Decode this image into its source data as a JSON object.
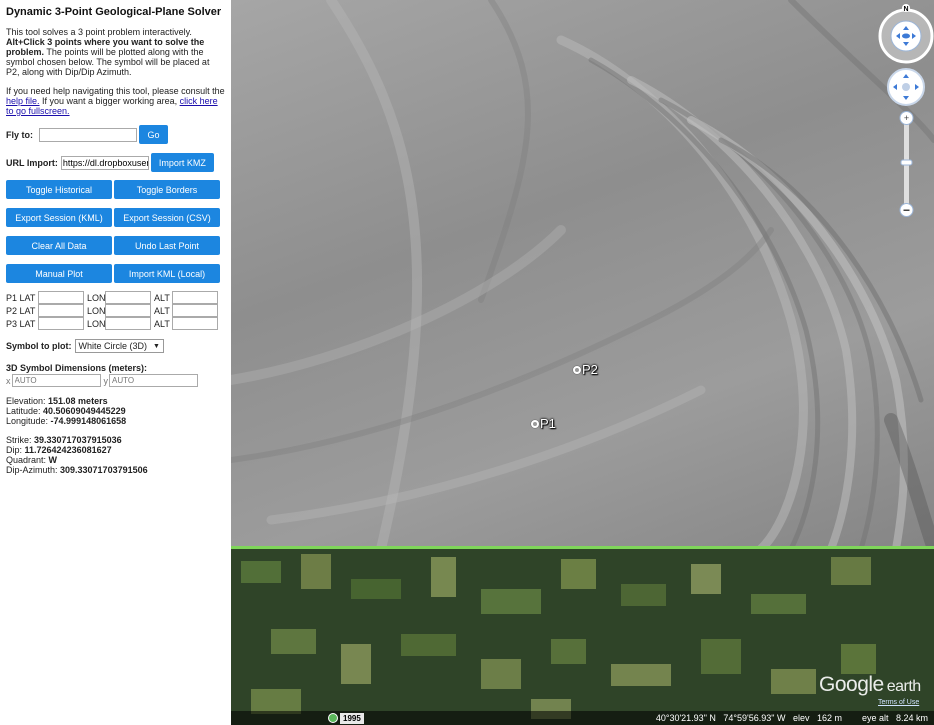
{
  "panel": {
    "title": "Dynamic 3-Point Geological-Plane Solver",
    "intro_line1": "This tool solves a 3 point problem interactively.",
    "intro_bold": "Alt+Click 3 points where you want to solve the problem.",
    "intro_rest": " The points will be plotted along with the symbol chosen below. The symbol will be placed at P2, along with Dip/Dip Azimuth.",
    "help_prefix": "If you need help navigating this tool, please consult the ",
    "help_link": "help file.",
    "help_mid": " If you want a bigger working area, ",
    "fullscreen_link": "click here to go fullscreen.",
    "fly_label": "Fly to:",
    "fly_value": "",
    "go_label": "Go",
    "url_label": "URL Import:",
    "url_value": "https://dl.dropboxuser",
    "import_kmz_label": "Import KMZ",
    "buttons": {
      "toggle_historical": "Toggle Historical",
      "toggle_borders": "Toggle Borders",
      "export_kml": "Export Session (KML)",
      "export_csv": "Export Session (CSV)",
      "clear_all": "Clear All Data",
      "undo_last": "Undo Last Point",
      "manual_plot": "Manual Plot",
      "import_kml_local": "Import KML (Local)"
    },
    "coord_rows": [
      {
        "p": "P1 LAT",
        "lon": "LON",
        "alt": "ALT"
      },
      {
        "p": "P2 LAT",
        "lon": "LON",
        "alt": "ALT"
      },
      {
        "p": "P3 LAT",
        "lon": "LON",
        "alt": "ALT"
      }
    ],
    "symbol_label": "Symbol to plot:",
    "symbol_value": "White Circle (3D)",
    "dim_title": "3D Symbol Dimensions (meters):",
    "dim_x_label": "x",
    "dim_y_label": "y",
    "dim_x_placeholder": "AUTO",
    "dim_y_placeholder": "AUTO",
    "elevation_label": "Elevation: ",
    "elevation_value": "151.08 meters",
    "latitude_label": "Latitude: ",
    "latitude_value": "40.50609049445229",
    "longitude_label": "Longitude: ",
    "longitude_value": "-74.999148061658",
    "strike_label": "Strike: ",
    "strike_value": "39.330717037915036",
    "dip_label": "Dip: ",
    "dip_value": "11.726424236081627",
    "quadrant_label": "Quadrant: ",
    "quadrant_value": "W",
    "dipaz_label": "Dip-Azimuth: ",
    "dipaz_value": "309.33071703791506"
  },
  "map": {
    "placemarks": [
      {
        "label": "P2"
      },
      {
        "label": "P1"
      }
    ],
    "compass_letter": "N",
    "year_badge": "1995",
    "status_coords": "40°30'21.93\" N   74°59'56.93\" W   elev   162 m        eye alt   8.24 km",
    "logo_google": "Google",
    "logo_earth": "earth",
    "terms_link": "Terms of Use",
    "icons": [
      "compass-ring-icon",
      "look-joystick-icon",
      "move-joystick-icon",
      "zoom-slider-icon",
      "historical-clock-icon"
    ]
  }
}
